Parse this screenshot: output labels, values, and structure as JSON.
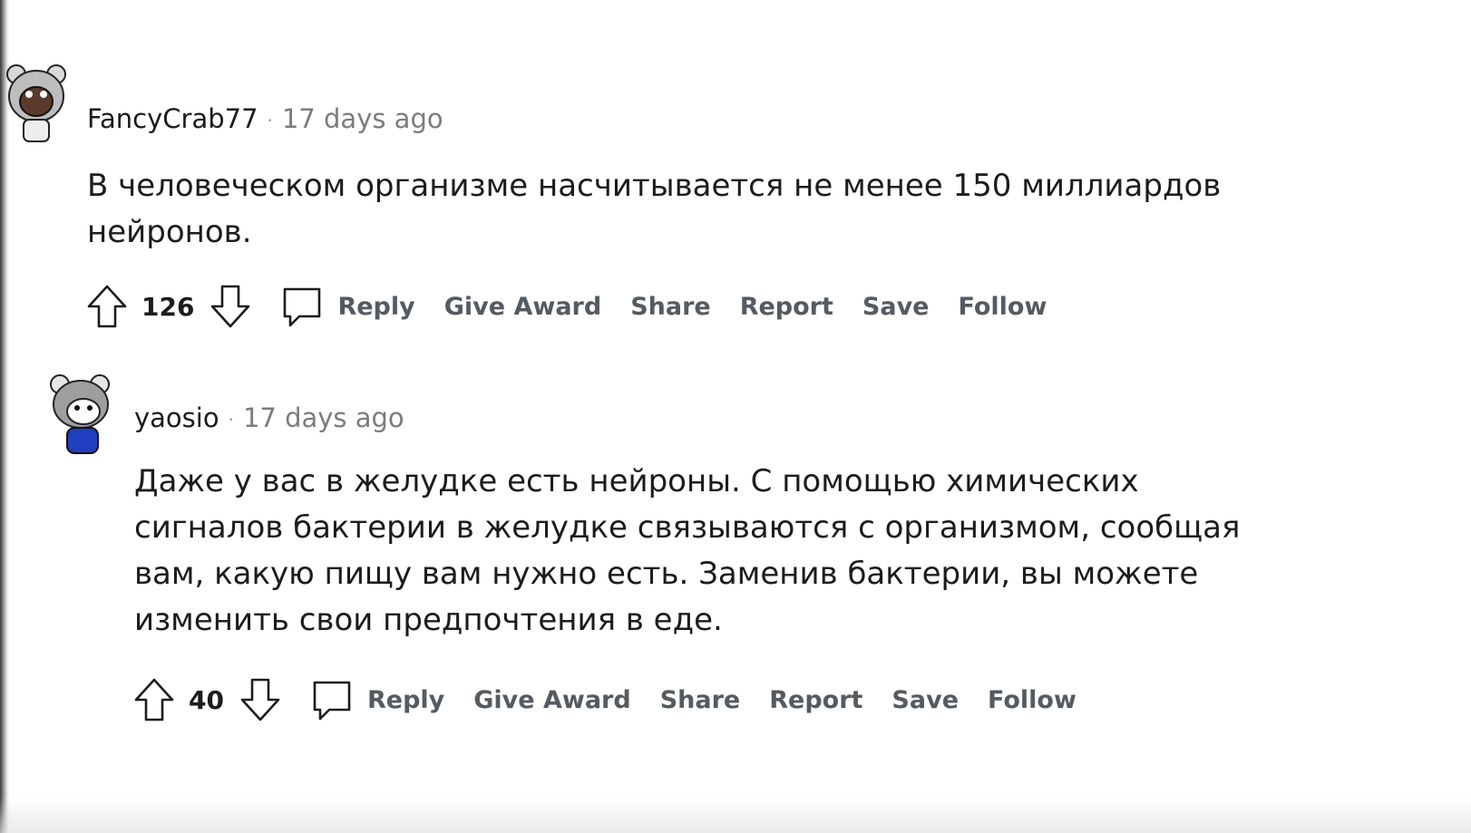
{
  "comments": [
    {
      "username": "FancyCrab77",
      "separator": "·",
      "timestamp": "17 days ago",
      "body_lines": [
        "В человеческом организме насчитывается не менее 150 миллиардов",
        "нейронов."
      ],
      "score": "126",
      "actions": {
        "reply": "Reply",
        "give_award": "Give Award",
        "share": "Share",
        "report": "Report",
        "save": "Save",
        "follow": "Follow"
      }
    },
    {
      "username": "yaosio",
      "separator": "·",
      "timestamp": "17 days ago",
      "body_lines": [
        "Даже у вас в желудке есть нейроны. С помощью химических",
        "сигналов бактерии в желудке связываются с организмом, сообщая",
        "вам, какую пищу вам нужно есть. Заменив бактерии, вы можете",
        "изменить свои предпочтения в еде."
      ],
      "score": "40",
      "actions": {
        "reply": "Reply",
        "give_award": "Give Award",
        "share": "Share",
        "report": "Report",
        "save": "Save",
        "follow": "Follow"
      }
    }
  ],
  "colors": {
    "text": "#1c1c1c",
    "meta": "#7c7c7c",
    "action": "#555b60",
    "avatar_shirt": "#1f3fbf"
  }
}
